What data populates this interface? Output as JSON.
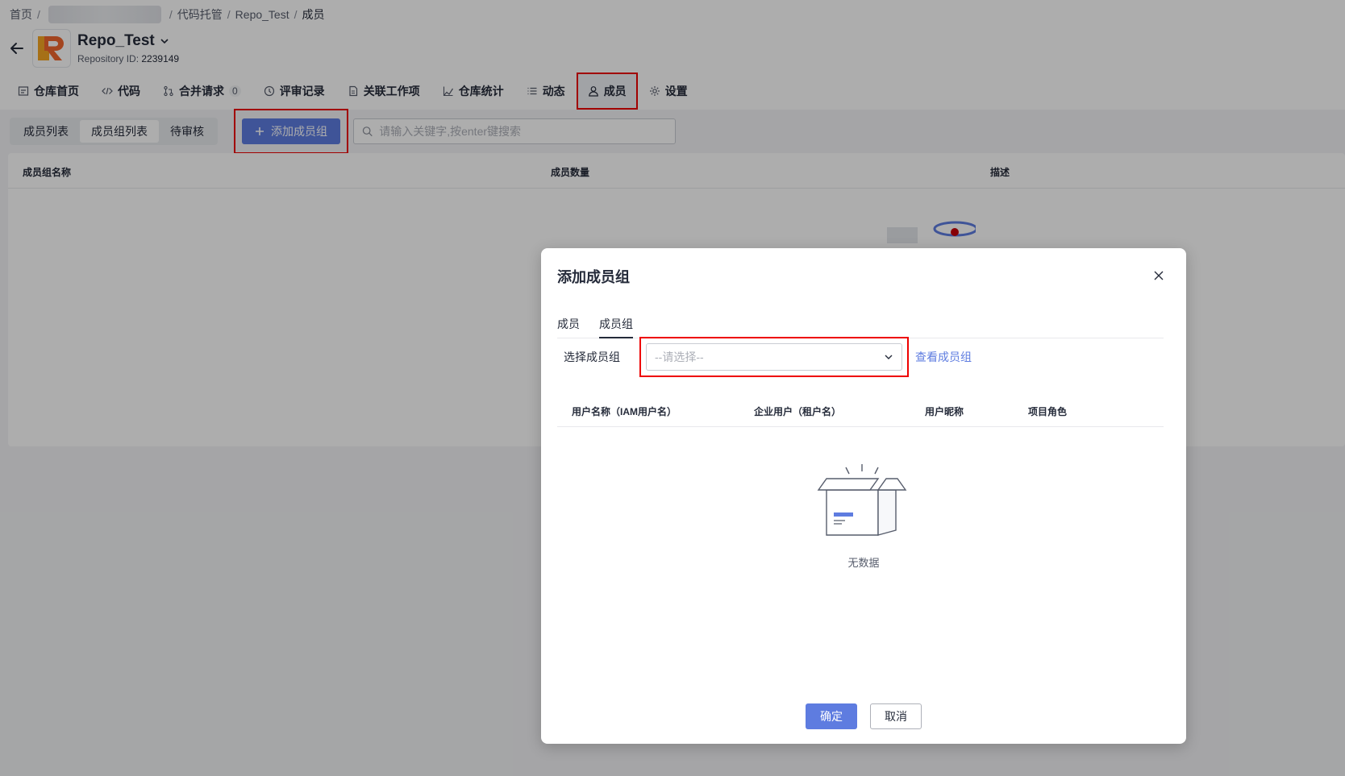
{
  "breadcrumb": {
    "home": "首页",
    "code_hosting": "代码托管",
    "repo": "Repo_Test",
    "current": "成员"
  },
  "repo": {
    "name": "Repo_Test",
    "id_label": "Repository ID:",
    "id_value": "2239149"
  },
  "nav_tabs": [
    {
      "label": "仓库首页",
      "icon": "file-icon"
    },
    {
      "label": "代码",
      "icon": "code-icon"
    },
    {
      "label": "合并请求",
      "icon": "merge-icon",
      "badge": "0"
    },
    {
      "label": "评审记录",
      "icon": "clock-icon"
    },
    {
      "label": "关联工作项",
      "icon": "doc-icon"
    },
    {
      "label": "仓库统计",
      "icon": "chart-icon"
    },
    {
      "label": "动态",
      "icon": "list-icon"
    },
    {
      "label": "成员",
      "icon": "user-icon",
      "active": true
    },
    {
      "label": "设置",
      "icon": "gear-icon"
    }
  ],
  "subtabs": [
    "成员列表",
    "成员组列表",
    "待审核"
  ],
  "active_subtab": "成员组列表",
  "toolbar": {
    "add_label": "添加成员组",
    "search_placeholder": "请输入关键字,按enter键搜索"
  },
  "table": {
    "columns": [
      "成员组名称",
      "成员数量",
      "描述"
    ]
  },
  "dialog": {
    "title": "添加成员组",
    "tabs": [
      "成员",
      "成员组"
    ],
    "active_tab": "成员组",
    "select_label": "选择成员组",
    "select_placeholder": "--请选择--",
    "view_link": "查看成员组",
    "columns": [
      "用户名称（IAM用户名）",
      "企业用户（租户名）",
      "用户昵称",
      "项目角色"
    ],
    "empty_text": "无数据",
    "confirm": "确定",
    "cancel": "取消"
  },
  "colors": {
    "primary": "#5e7ce0",
    "highlight": "#ee0000"
  }
}
